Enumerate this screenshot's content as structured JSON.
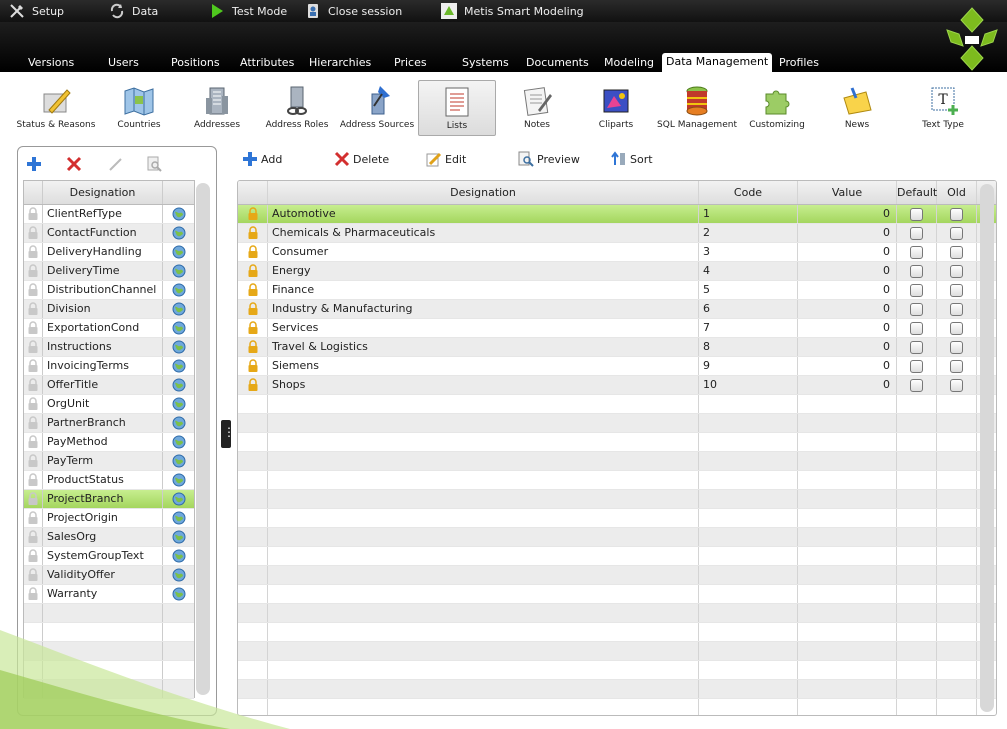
{
  "topbar": {
    "setup": "Setup",
    "data": "Data",
    "test_mode": "Test Mode",
    "close_session": "Close session",
    "app_name": "Metis Smart Modeling"
  },
  "tabs": [
    "Versions",
    "Users",
    "Positions",
    "Attributes",
    "Hierarchies",
    "Prices",
    "Systems",
    "Documents",
    "Modeling",
    "Data Management",
    "Profiles"
  ],
  "active_tab": "Data Management",
  "toolbar": {
    "items": [
      "Status & Reasons",
      "Countries",
      "Addresses",
      "Address Roles",
      "Address Sources",
      "Lists",
      "Notes",
      "Cliparts",
      "SQL Management",
      "Customizing",
      "News",
      "Text Type"
    ],
    "active": "Lists"
  },
  "left": {
    "header": "Designation",
    "selected": "ProjectBranch",
    "items": [
      "ClientRefType",
      "ContactFunction",
      "DeliveryHandling",
      "DeliveryTime",
      "DistributionChannel",
      "Division",
      "ExportationCond",
      "Instructions",
      "InvoicingTerms",
      "OfferTitle",
      "OrgUnit",
      "PartnerBranch",
      "PayMethod",
      "PayTerm",
      "ProductStatus",
      "ProjectBranch",
      "ProjectOrigin",
      "SalesOrg",
      "SystemGroupText",
      "ValidityOffer",
      "Warranty"
    ]
  },
  "actions": {
    "add": "Add",
    "delete": "Delete",
    "edit": "Edit",
    "preview": "Preview",
    "sort": "Sort"
  },
  "grid": {
    "headers": {
      "designation": "Designation",
      "code": "Code",
      "value": "Value",
      "default": "Default",
      "old": "Old"
    },
    "selected_index": 0,
    "rows": [
      {
        "designation": "Automotive",
        "code": "1",
        "value": "0"
      },
      {
        "designation": "Chemicals & Pharmaceuticals",
        "code": "2",
        "value": "0"
      },
      {
        "designation": "Consumer",
        "code": "3",
        "value": "0"
      },
      {
        "designation": "Energy",
        "code": "4",
        "value": "0"
      },
      {
        "designation": "Finance",
        "code": "5",
        "value": "0"
      },
      {
        "designation": "Industry & Manufacturing",
        "code": "6",
        "value": "0"
      },
      {
        "designation": "Services",
        "code": "7",
        "value": "0"
      },
      {
        "designation": "Travel & Logistics",
        "code": "8",
        "value": "0"
      },
      {
        "designation": "Siemens",
        "code": "9",
        "value": "0"
      },
      {
        "designation": "Shops",
        "code": "10",
        "value": "0"
      }
    ]
  }
}
